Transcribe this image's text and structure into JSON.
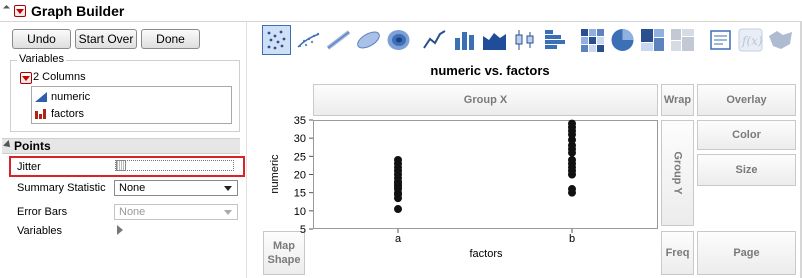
{
  "title": "Graph Builder",
  "buttons": {
    "undo": "Undo",
    "start_over": "Start Over",
    "done": "Done"
  },
  "variables": {
    "section_label": "Variables",
    "columns_label": "2 Columns",
    "columns": [
      {
        "name": "numeric",
        "icon": "continuous-icon"
      },
      {
        "name": "factors",
        "icon": "nominal-icon"
      }
    ]
  },
  "points": {
    "section_label": "Points",
    "jitter_label": "Jitter",
    "summary_label": "Summary Statistic",
    "summary_value": "None",
    "errorbars_label": "Error Bars",
    "errorbars_value": "None",
    "variables_label": "Variables"
  },
  "toolbar": {
    "icons": [
      "points-icon",
      "smoother-icon",
      "line-of-fit-icon",
      "ellipse-icon",
      "contour-icon",
      "line-icon",
      "bar-icon",
      "area-icon",
      "box-plot-icon",
      "histogram-icon",
      "heatmap-icon",
      "pie-icon",
      "treemap-icon",
      "mosaic-icon",
      "caption-box-icon",
      "formula-icon",
      "map-shapes-icon"
    ],
    "active": "points-icon"
  },
  "zones": {
    "group_x": "Group X",
    "wrap": "Wrap",
    "overlay": "Overlay",
    "group_y": "Group Y",
    "color": "Color",
    "size": "Size",
    "map_line1": "Map",
    "map_line2": "Shape",
    "freq": "Freq",
    "page": "Page"
  },
  "chart_data": {
    "type": "scatter",
    "title": "numeric vs. factors",
    "xlabel": "factors",
    "ylabel": "numeric",
    "categories": [
      "a",
      "b"
    ],
    "ylim": [
      5,
      35
    ],
    "yticks": [
      5,
      10,
      15,
      20,
      25,
      30,
      35
    ],
    "grid": false,
    "series": [
      {
        "category": "a",
        "values": [
          10.5,
          13.5,
          14.5,
          15,
          16,
          16.5,
          17,
          17.5,
          18,
          19,
          20,
          21,
          22,
          23,
          24
        ]
      },
      {
        "category": "b",
        "values": [
          15,
          16,
          20,
          21,
          22,
          23,
          24,
          26,
          27,
          28,
          29.5,
          31,
          32,
          33,
          34
        ]
      }
    ]
  },
  "colors": {
    "accent": "#3b6fb6",
    "highlight": "#d8232a",
    "menu_red": "#cc0000"
  }
}
